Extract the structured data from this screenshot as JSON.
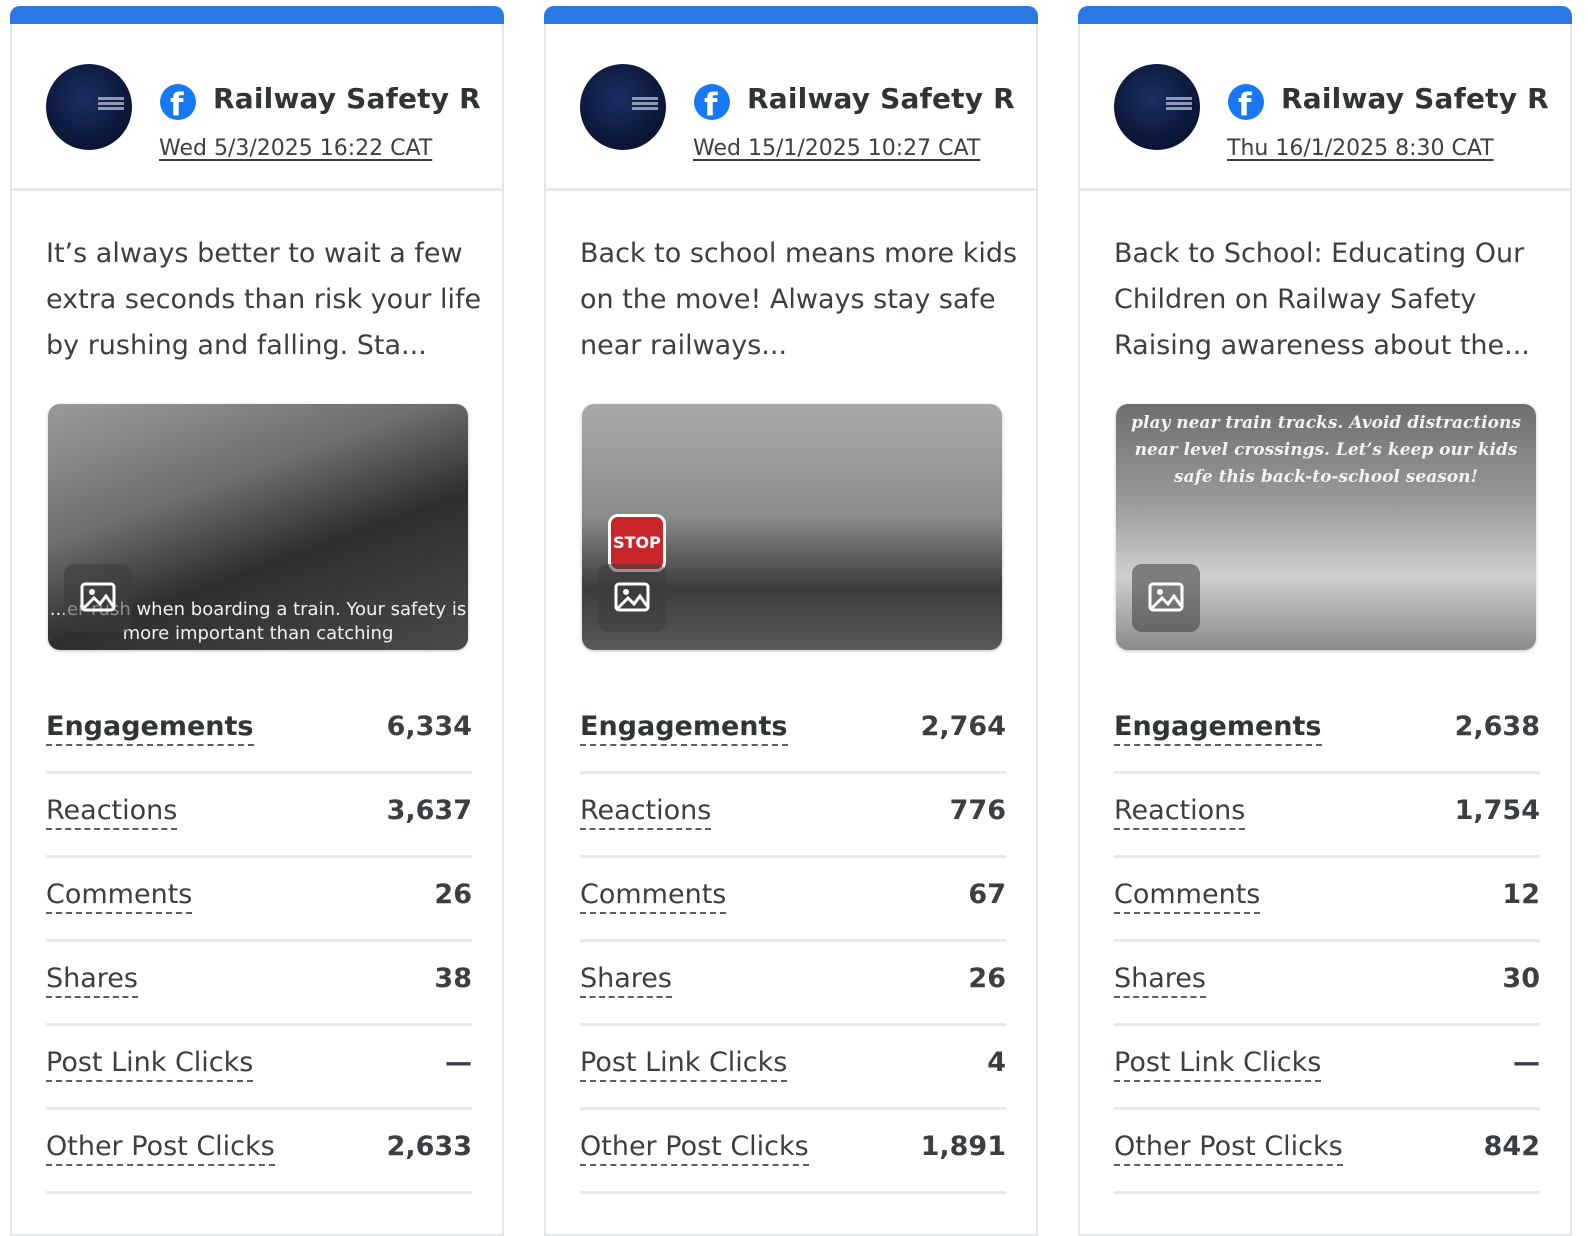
{
  "cards": [
    {
      "page_name": "Railway Safety R...",
      "date": "Wed 5/3/2025 16:22 CAT",
      "text": "It’s always better to wait a few extra seconds than risk your life by rushing and falling. Sta...",
      "image_caption": "...er rush when boarding a train. Your safety is more important than catching",
      "metrics": [
        {
          "label": "Engagements",
          "value": "6,334"
        },
        {
          "label": "Reactions",
          "value": "3,637"
        },
        {
          "label": "Comments",
          "value": "26"
        },
        {
          "label": "Shares",
          "value": "38"
        },
        {
          "label": "Post Link Clicks",
          "value": "—"
        },
        {
          "label": "Other Post Clicks",
          "value": "2,633"
        }
      ]
    },
    {
      "page_name": "Railway Safety R...",
      "date": "Wed 15/1/2025 10:27 CAT",
      "text": "Back to school means more kids on the move! Always stay safe near railways...",
      "image_sign": "STOP",
      "metrics": [
        {
          "label": "Engagements",
          "value": "2,764"
        },
        {
          "label": "Reactions",
          "value": "776"
        },
        {
          "label": "Comments",
          "value": "67"
        },
        {
          "label": "Shares",
          "value": "26"
        },
        {
          "label": "Post Link Clicks",
          "value": "4"
        },
        {
          "label": "Other Post Clicks",
          "value": "1,891"
        }
      ]
    },
    {
      "page_name": "Railway Safety R...",
      "date": "Thu 16/1/2025 8:30 CAT",
      "text": "Back to School: Educating Our Children on Railway Safety Raising awareness about the...",
      "image_caption": "play near train tracks. Avoid distractions near level crossings. Let’s keep our kids safe this back-to-school season!",
      "metrics": [
        {
          "label": "Engagements",
          "value": "2,638"
        },
        {
          "label": "Reactions",
          "value": "1,754"
        },
        {
          "label": "Comments",
          "value": "12"
        },
        {
          "label": "Shares",
          "value": "30"
        },
        {
          "label": "Post Link Clicks",
          "value": "—"
        },
        {
          "label": "Other Post Clicks",
          "value": "842"
        }
      ]
    }
  ],
  "icons": {
    "network": "facebook-icon",
    "media": "image-icon"
  },
  "colors": {
    "accent_bar": "#2a78e4",
    "facebook": "#1877f2"
  }
}
